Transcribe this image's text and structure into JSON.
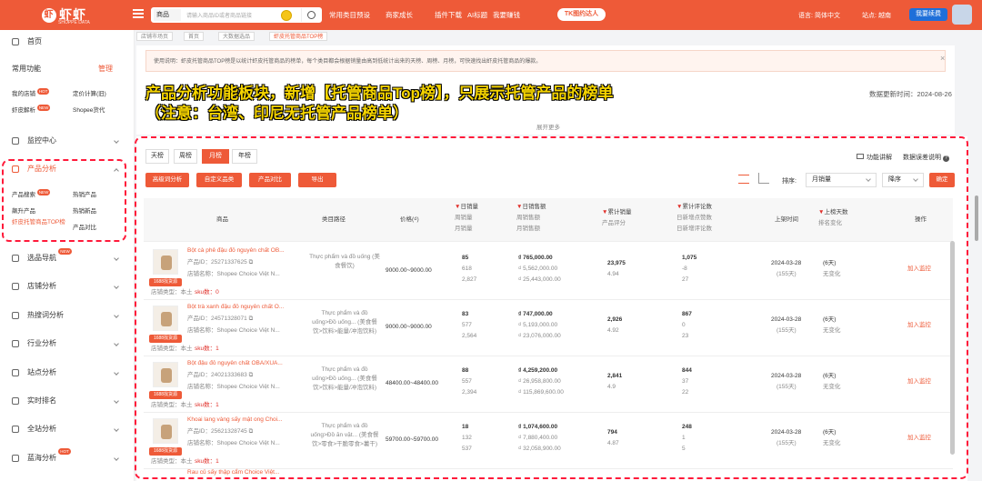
{
  "header": {
    "logo": "虾虾",
    "logo_sub": "SHOPPE DATA",
    "search_category": "商品",
    "search_placeholder": "请输入商品ID或者商品链接",
    "nav": [
      "常用类目预设",
      "商家成长",
      "插件下载",
      "AI标题",
      "我要赚钱"
    ],
    "tk_button": "TK图约达人",
    "language_label": "语言:",
    "language": "简体中文",
    "site_label": "站点:",
    "site": "越南",
    "renew_button": "我要续费"
  },
  "sidebar": {
    "home": "首页",
    "common_label": "常用功能",
    "manage": "管理",
    "my_shop": "我的店铺",
    "profit_calc": "定价计算(旧)",
    "shrimp_lab": "虾皮解析",
    "shopee_go": "Shopee货代",
    "monitor": "监控中心",
    "product_analysis": "产品分析",
    "sub_items": {
      "search": "产品搜索",
      "hot": "热销产品",
      "rising": "飙升产品",
      "new_hot": "热销新品",
      "top_list": "虾皮托管商品TOP榜",
      "compare": "产品对比"
    },
    "badge_new": "NEW",
    "badge_hot": "HOT",
    "menu": [
      "选品导航",
      "店铺分析",
      "热搜词分析",
      "行业分析",
      "站点分析",
      "实时排名",
      "全站分析",
      "蓝海分析"
    ]
  },
  "breadcrumbs": [
    "店铺市场页",
    "首页",
    "大数据选品",
    "虾皮托管商品TOP榜"
  ],
  "notice": "使用说明：虾皮托管商品TOP榜是以统计虾皮托管商品的榜单，每个类目都会根据销量由高到低统计出来的天榜、周榜、月榜，可快速找出虾皮托管商品的爆款。",
  "update_time_label": "数据更新时间：",
  "update_time": "2024-08-26",
  "expand_more": "展开更多",
  "annotation": {
    "line1": "产品分析功能板块，新增【托管商品Top榜】，只展示托管产品的榜单",
    "line2": "（注意：台湾、印尼无托管产品榜单）"
  },
  "tabs": [
    "天榜",
    "周榜",
    "月榜",
    "年榜"
  ],
  "active_tab": "月榜",
  "help_links": {
    "explain": "功能讲解",
    "data_note": "数据误差说明"
  },
  "buttons": [
    "高级词分析",
    "自定义品类",
    "产品对比",
    "导出"
  ],
  "sort": {
    "label": "排序:",
    "field": "月销量",
    "order": "降序",
    "confirm": "确定"
  },
  "table_headers": {
    "product": "商品",
    "category": "类目路径",
    "price": "价格(₫)",
    "daily_sales": "日销量",
    "weekly_sales": "周销量",
    "monthly_sales": "月销量",
    "daily_revenue": "日销售额",
    "weekly_revenue": "周销售额",
    "monthly_revenue": "月销售额",
    "total_sales": "累计销量",
    "rating": "产品评分",
    "total_reviews": "累计评论数",
    "new_reviews": "日新增点赞数",
    "daily_reviews": "日新增评论数",
    "listed": "上架时间",
    "days_listed": "上榜天数",
    "rank_change": "排名变化",
    "action": "操作"
  },
  "rows": [
    {
      "name": "Bột cà phê đậu đỏ nguyên chất OB...",
      "id_label": "产品ID：",
      "id": "25271337625",
      "shop_label": "店铺名称：",
      "shop": "Shopee Choice Việt N...",
      "shop_type_label": "店铺类型：",
      "shop_type": "本土",
      "sku_label": "sku数：",
      "sku": "0",
      "tag": "1688找货源",
      "category": "Thực phẩm và đồ uống (美食餐饮)",
      "price": "9000.00~9000.00",
      "daily": "85",
      "weekly": "618",
      "monthly": "2,827",
      "rev_d": "₫ 765,000.00",
      "rev_w": "₫ 5,562,000.00",
      "rev_m": "₫ 25,443,000.00",
      "total": "23,975",
      "rating": "4.94",
      "reviews": "1,075",
      "rev_new1": "-8",
      "rev_new2": "27",
      "listed": "2024-03-28",
      "listed_days": "(155天)",
      "days": "(6天)",
      "change": "无变化",
      "action": "加入监控"
    },
    {
      "name": "Bột trà xanh đậu đỏ nguyên chất O...",
      "id_label": "产品ID：",
      "id": "24571328071",
      "shop_label": "店铺名称：",
      "shop": "Shopee Choice Việt N...",
      "shop_type_label": "店铺类型：",
      "shop_type": "本土",
      "sku_label": "sku数：",
      "sku": "1",
      "tag": "1688找货源",
      "category": "Thực phẩm và đồ uống>Đồ uống... (美食餐饮>饮料>能量/冲泡饮料)",
      "price": "9000.00~9000.00",
      "daily": "83",
      "weekly": "577",
      "monthly": "2,564",
      "rev_d": "₫ 747,000.00",
      "rev_w": "₫ 5,193,000.00",
      "rev_m": "₫ 23,076,000.00",
      "total": "2,926",
      "rating": "4.92",
      "reviews": "867",
      "rev_new1": "0",
      "rev_new2": "23",
      "listed": "2024-03-28",
      "listed_days": "(155天)",
      "days": "(6天)",
      "change": "无变化",
      "action": "加入监控"
    },
    {
      "name": "Bột đậu đỏ nguyên chất OBA/XUA...",
      "id_label": "产品ID：",
      "id": "24021333683",
      "shop_label": "店铺名称：",
      "shop": "Shopee Choice Việt N...",
      "shop_type_label": "店铺类型：",
      "shop_type": "本土",
      "sku_label": "sku数：",
      "sku": "1",
      "tag": "1688找货源",
      "category": "Thực phẩm và đồ uống>Đồ uống... (美食餐饮>饮料>能量/冲泡饮料)",
      "price": "48400.00~48400.00",
      "daily": "88",
      "weekly": "557",
      "monthly": "2,394",
      "rev_d": "₫ 4,259,200.00",
      "rev_w": "₫ 26,958,800.00",
      "rev_m": "₫ 115,869,600.00",
      "total": "2,841",
      "rating": "4.9",
      "reviews": "844",
      "rev_new1": "37",
      "rev_new2": "22",
      "listed": "2024-03-28",
      "listed_days": "(155天)",
      "days": "(6天)",
      "change": "无变化",
      "action": "加入监控"
    },
    {
      "name": "Khoai lang vàng sấy mật ong Choi...",
      "id_label": "产品ID：",
      "id": "25621328745",
      "shop_label": "店铺名称：",
      "shop": "Shopee Choice Việt N...",
      "shop_type_label": "店铺类型：",
      "shop_type": "本土",
      "sku_label": "sku数：",
      "sku": "1",
      "tag": "1688找货源",
      "category": "Thực phẩm và đồ uống>Đồ ăn vặt... (美食餐饮>零食>干脆零食>薯干)",
      "price": "59700.00~59700.00",
      "daily": "18",
      "weekly": "132",
      "monthly": "537",
      "rev_d": "₫ 1,074,600.00",
      "rev_w": "₫ 7,880,400.00",
      "rev_m": "₫ 32,058,900.00",
      "total": "794",
      "rating": "4.87",
      "reviews": "248",
      "rev_new1": "1",
      "rev_new2": "5",
      "listed": "2024-03-28",
      "listed_days": "(155天)",
      "days": "(6天)",
      "change": "无变化",
      "action": "加入监控"
    }
  ],
  "partial_row": "Rau củ sấy thập cẩm Choice Việt..."
}
